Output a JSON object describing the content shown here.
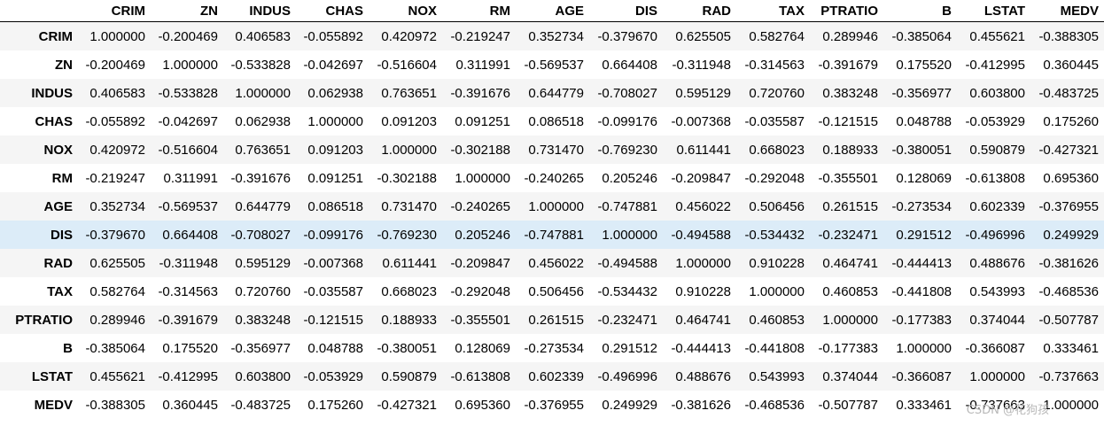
{
  "table": {
    "index_header": "",
    "columns": [
      "CRIM",
      "ZN",
      "INDUS",
      "CHAS",
      "NOX",
      "RM",
      "AGE",
      "DIS",
      "RAD",
      "TAX",
      "PTRATIO",
      "B",
      "LSTAT",
      "MEDV"
    ],
    "highlighted_row": "DIS",
    "row_colors": {
      "odd": "#f5f5f5",
      "even": "#ffffff",
      "highlight": "#dcecf8"
    },
    "rows": [
      {
        "label": "CRIM",
        "values": [
          "1.000000",
          "-0.200469",
          "0.406583",
          "-0.055892",
          "0.420972",
          "-0.219247",
          "0.352734",
          "-0.379670",
          "0.625505",
          "0.582764",
          "0.289946",
          "-0.385064",
          "0.455621",
          "-0.388305"
        ]
      },
      {
        "label": "ZN",
        "values": [
          "-0.200469",
          "1.000000",
          "-0.533828",
          "-0.042697",
          "-0.516604",
          "0.311991",
          "-0.569537",
          "0.664408",
          "-0.311948",
          "-0.314563",
          "-0.391679",
          "0.175520",
          "-0.412995",
          "0.360445"
        ]
      },
      {
        "label": "INDUS",
        "values": [
          "0.406583",
          "-0.533828",
          "1.000000",
          "0.062938",
          "0.763651",
          "-0.391676",
          "0.644779",
          "-0.708027",
          "0.595129",
          "0.720760",
          "0.383248",
          "-0.356977",
          "0.603800",
          "-0.483725"
        ]
      },
      {
        "label": "CHAS",
        "values": [
          "-0.055892",
          "-0.042697",
          "0.062938",
          "1.000000",
          "0.091203",
          "0.091251",
          "0.086518",
          "-0.099176",
          "-0.007368",
          "-0.035587",
          "-0.121515",
          "0.048788",
          "-0.053929",
          "0.175260"
        ]
      },
      {
        "label": "NOX",
        "values": [
          "0.420972",
          "-0.516604",
          "0.763651",
          "0.091203",
          "1.000000",
          "-0.302188",
          "0.731470",
          "-0.769230",
          "0.611441",
          "0.668023",
          "0.188933",
          "-0.380051",
          "0.590879",
          "-0.427321"
        ]
      },
      {
        "label": "RM",
        "values": [
          "-0.219247",
          "0.311991",
          "-0.391676",
          "0.091251",
          "-0.302188",
          "1.000000",
          "-0.240265",
          "0.205246",
          "-0.209847",
          "-0.292048",
          "-0.355501",
          "0.128069",
          "-0.613808",
          "0.695360"
        ]
      },
      {
        "label": "AGE",
        "values": [
          "0.352734",
          "-0.569537",
          "0.644779",
          "0.086518",
          "0.731470",
          "-0.240265",
          "1.000000",
          "-0.747881",
          "0.456022",
          "0.506456",
          "0.261515",
          "-0.273534",
          "0.602339",
          "-0.376955"
        ]
      },
      {
        "label": "DIS",
        "values": [
          "-0.379670",
          "0.664408",
          "-0.708027",
          "-0.099176",
          "-0.769230",
          "0.205246",
          "-0.747881",
          "1.000000",
          "-0.494588",
          "-0.534432",
          "-0.232471",
          "0.291512",
          "-0.496996",
          "0.249929"
        ]
      },
      {
        "label": "RAD",
        "values": [
          "0.625505",
          "-0.311948",
          "0.595129",
          "-0.007368",
          "0.611441",
          "-0.209847",
          "0.456022",
          "-0.494588",
          "1.000000",
          "0.910228",
          "0.464741",
          "-0.444413",
          "0.488676",
          "-0.381626"
        ]
      },
      {
        "label": "TAX",
        "values": [
          "0.582764",
          "-0.314563",
          "0.720760",
          "-0.035587",
          "0.668023",
          "-0.292048",
          "0.506456",
          "-0.534432",
          "0.910228",
          "1.000000",
          "0.460853",
          "-0.441808",
          "0.543993",
          "-0.468536"
        ]
      },
      {
        "label": "PTRATIO",
        "values": [
          "0.289946",
          "-0.391679",
          "0.383248",
          "-0.121515",
          "0.188933",
          "-0.355501",
          "0.261515",
          "-0.232471",
          "0.464741",
          "0.460853",
          "1.000000",
          "-0.177383",
          "0.374044",
          "-0.507787"
        ]
      },
      {
        "label": "B",
        "values": [
          "-0.385064",
          "0.175520",
          "-0.356977",
          "0.048788",
          "-0.380051",
          "0.128069",
          "-0.273534",
          "0.291512",
          "-0.444413",
          "-0.441808",
          "-0.177383",
          "1.000000",
          "-0.366087",
          "0.333461"
        ]
      },
      {
        "label": "LSTAT",
        "values": [
          "0.455621",
          "-0.412995",
          "0.603800",
          "-0.053929",
          "0.590879",
          "-0.613808",
          "0.602339",
          "-0.496996",
          "0.488676",
          "0.543993",
          "0.374044",
          "-0.366087",
          "1.000000",
          "-0.737663"
        ]
      },
      {
        "label": "MEDV",
        "values": [
          "-0.388305",
          "0.360445",
          "-0.483725",
          "0.175260",
          "-0.427321",
          "0.695360",
          "-0.376955",
          "0.249929",
          "-0.381626",
          "-0.468536",
          "-0.507787",
          "0.333461",
          "-0.737663",
          "1.000000"
        ]
      }
    ]
  },
  "watermark": "CSDN @花狗孩"
}
